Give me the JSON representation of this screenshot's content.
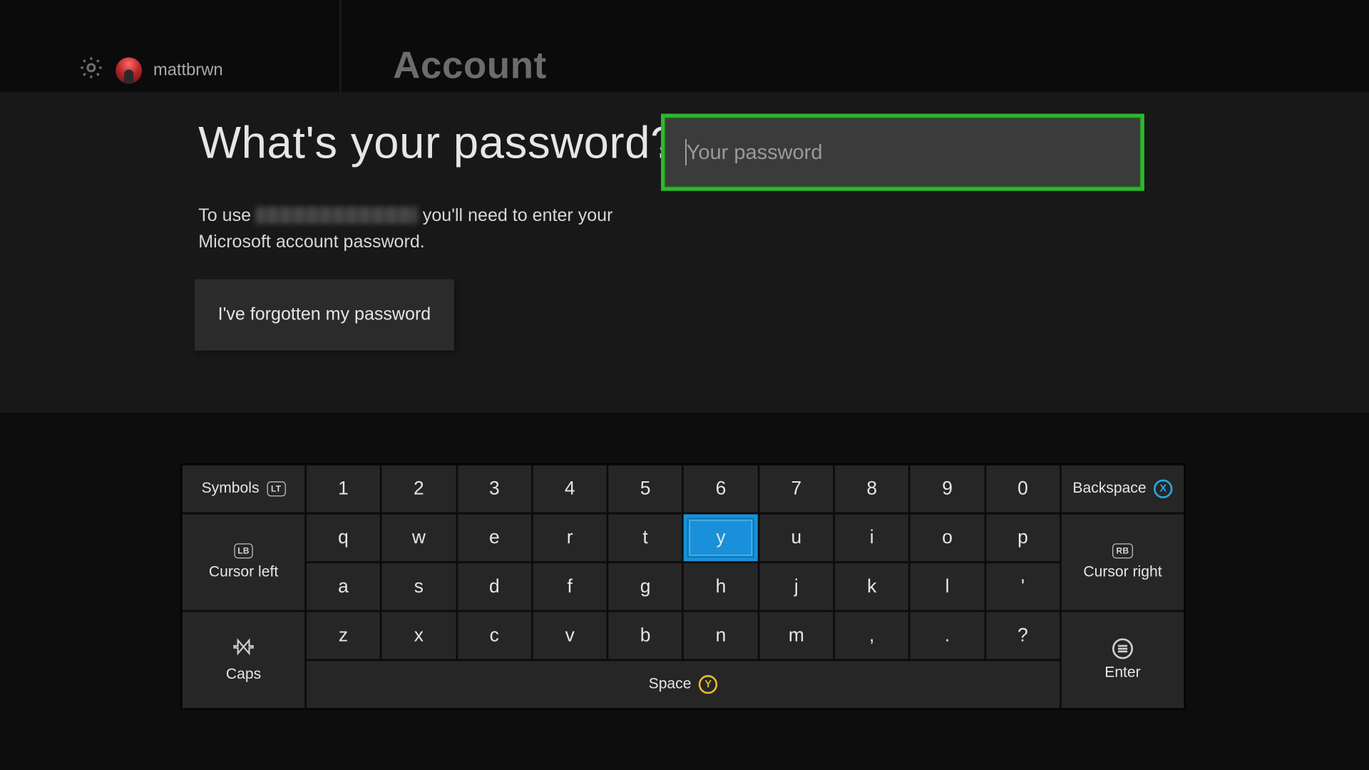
{
  "header": {
    "username": "mattbrwn",
    "page": "Account"
  },
  "main": {
    "heading": "What's your password?",
    "desc_pre": "To use ",
    "desc_post": " you'll need to enter your Microsoft account password.",
    "forgot": "I've forgotten my password",
    "placeholder": "Your password"
  },
  "keyboard": {
    "symbols": "Symbols",
    "symbols_hint": "LT",
    "backspace": "Backspace",
    "backspace_hint": "X",
    "cursor_left": "Cursor left",
    "cursor_left_hint": "LB",
    "cursor_right": "Cursor right",
    "cursor_right_hint": "RB",
    "caps": "Caps",
    "enter": "Enter",
    "space": "Space",
    "space_hint": "Y",
    "row_num": [
      "1",
      "2",
      "3",
      "4",
      "5",
      "6",
      "7",
      "8",
      "9",
      "0"
    ],
    "row1": [
      "q",
      "w",
      "e",
      "r",
      "t",
      "y",
      "u",
      "i",
      "o",
      "p"
    ],
    "row2": [
      "a",
      "s",
      "d",
      "f",
      "g",
      "h",
      "j",
      "k",
      "l",
      "'"
    ],
    "row3": [
      "z",
      "x",
      "c",
      "v",
      "b",
      "n",
      "m",
      ",",
      ".",
      "?"
    ],
    "selected": "y"
  },
  "colors": {
    "accent": "#2db82d",
    "selection": "#1990d9"
  }
}
